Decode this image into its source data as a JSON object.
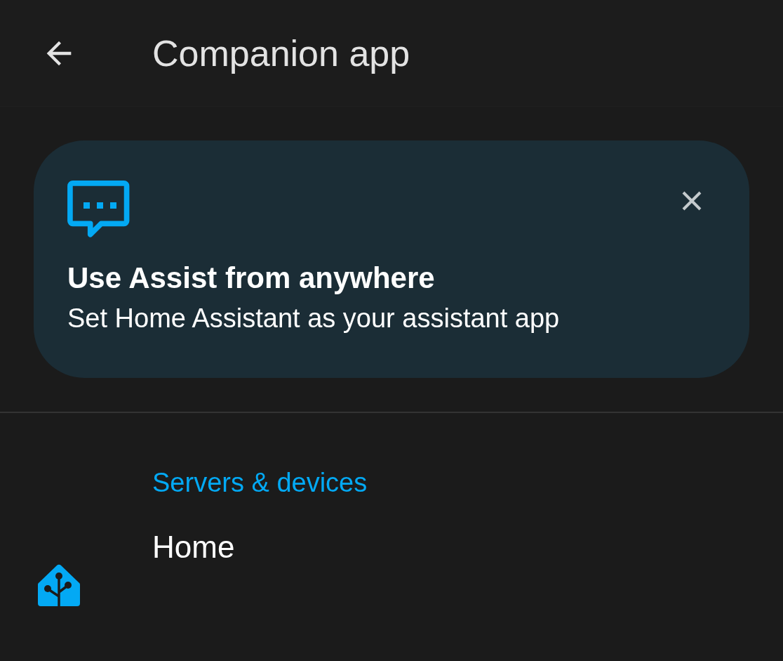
{
  "top_bar": {
    "title": "Companion app"
  },
  "banner": {
    "title": "Use Assist from anywhere",
    "subtitle": "Set Home Assistant as your assistant app"
  },
  "sections": [
    {
      "header": "Servers & devices",
      "items": [
        {
          "label": "Home"
        }
      ]
    }
  ]
}
